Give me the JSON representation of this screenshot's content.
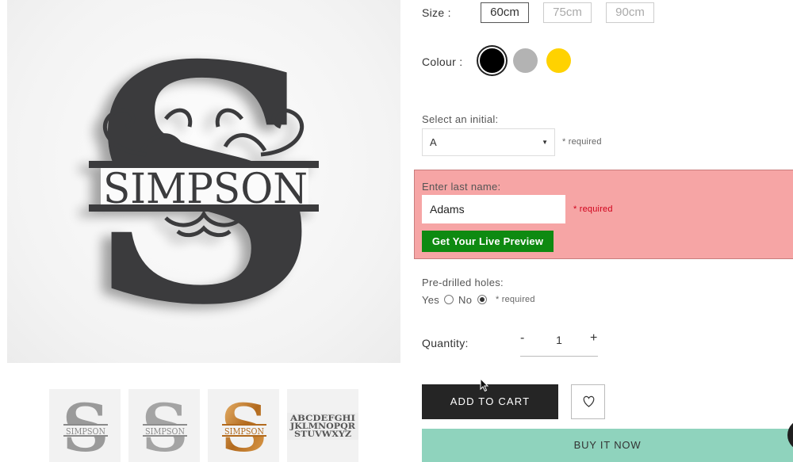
{
  "product_images": {
    "main_monogram_letter": "S",
    "main_monogram_name": "SIMPSON",
    "thumbnails": [
      {
        "letter": "S",
        "name": "SIMPSON",
        "finish": "silver"
      },
      {
        "letter": "S",
        "name": "SIMPSON",
        "finish": "brushed-steel"
      },
      {
        "letter": "S",
        "name": "SIMPSON",
        "finish": "copper"
      },
      {
        "rows": [
          "ABCDEFGHI",
          "JKLMNOPQR",
          "STUVWXYZ"
        ],
        "finish": "alphabet-sheet"
      }
    ]
  },
  "size": {
    "label": "Size :",
    "options": [
      "60cm",
      "75cm",
      "90cm"
    ],
    "selected": "60cm"
  },
  "colour": {
    "label": "Colour :",
    "swatches": [
      {
        "name": "black",
        "hex": "#000000",
        "selected": true
      },
      {
        "name": "silver",
        "hex": "#b3b3b3",
        "selected": false
      },
      {
        "name": "gold",
        "hex": "#ffd200",
        "selected": false
      }
    ]
  },
  "initial": {
    "label": "Select an initial:",
    "value": "A",
    "required": "* required"
  },
  "last_name": {
    "label": "Enter last name:",
    "value": "Adams",
    "required": "* required",
    "preview_button": "Get Your Live Preview"
  },
  "holes": {
    "label": "Pre-drilled holes:",
    "yes": "Yes",
    "no": "No",
    "selected": "No",
    "required": "* required"
  },
  "quantity": {
    "label": "Quantity:",
    "minus": "-",
    "value": "1",
    "plus": "+"
  },
  "actions": {
    "add_to_cart": "ADD TO CART",
    "buy_now": "BUY IT NOW"
  },
  "icons": {
    "wishlist": "heart-icon",
    "caret": "chevron-down-icon"
  },
  "colors": {
    "error_panel": "#f6a5a5",
    "preview_button": "#0e8a11",
    "add_to_cart": "#252525",
    "buy_now": "#8fd3bd"
  }
}
